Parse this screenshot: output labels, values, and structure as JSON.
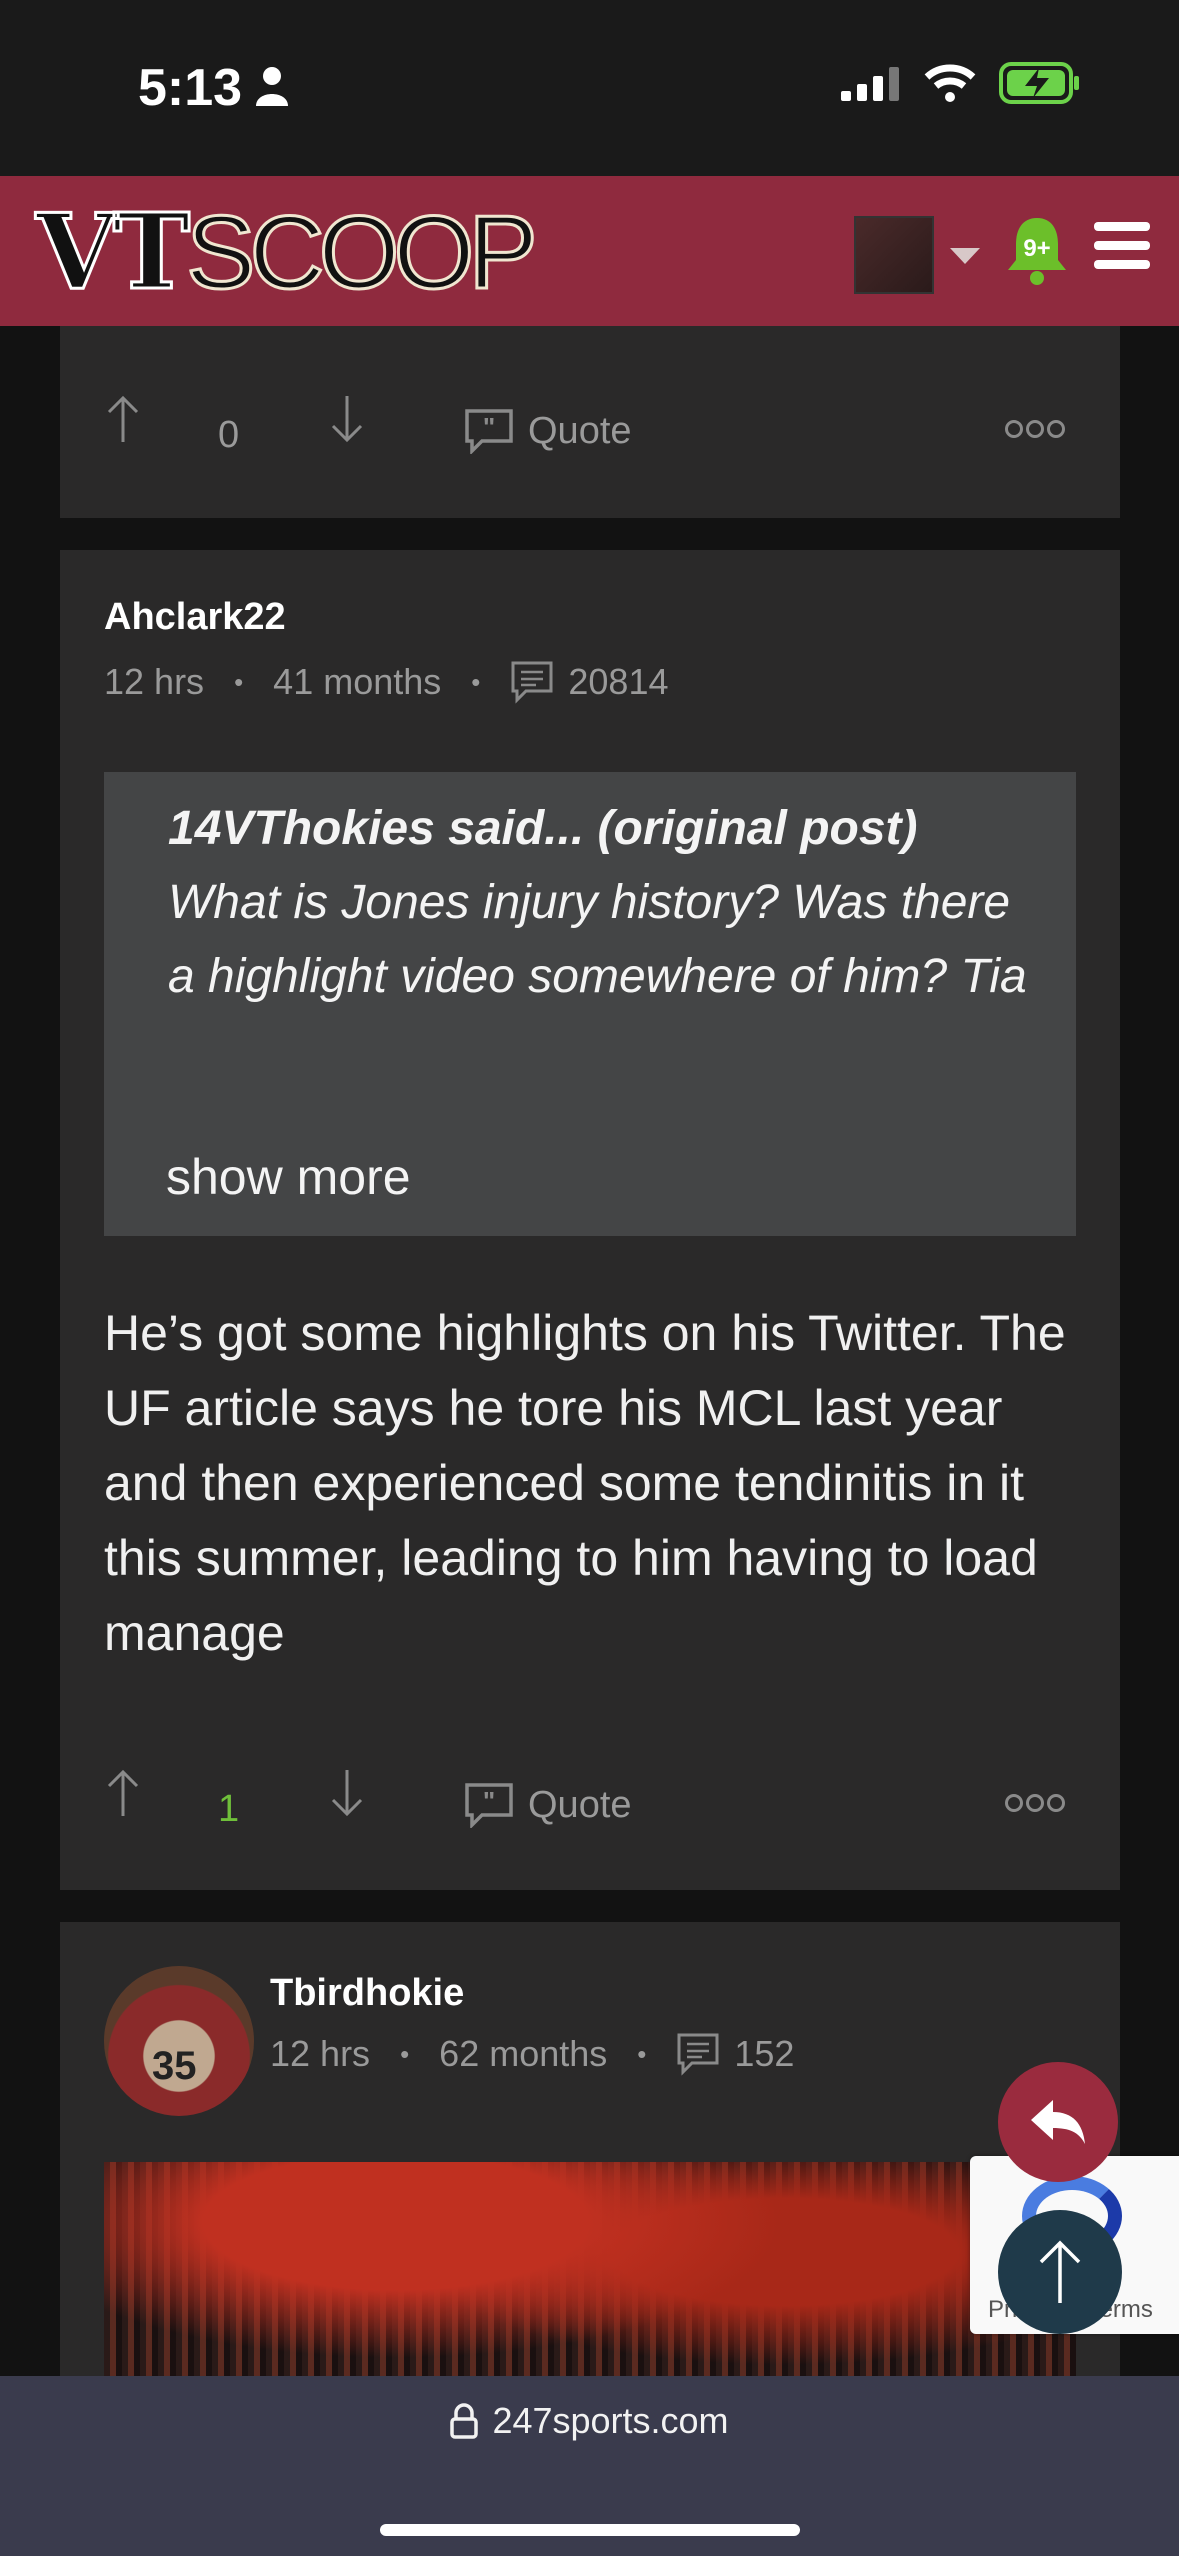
{
  "status_bar": {
    "time": "5:13"
  },
  "header": {
    "logo_vt": "VT",
    "logo_scoop": "SCOOP",
    "notification_badge": "9+"
  },
  "posts": [
    {
      "upvotes": "0",
      "quote_label": "Quote"
    },
    {
      "username": "Ahclark22",
      "posted": "12 hrs",
      "membership": "41 months",
      "post_count": "20814",
      "quote": {
        "attribution_name": "14VThokies said...",
        "attribution_link": "(original post)",
        "text": "What is Jones injury history? Was there a highlight video somewhere of him? Tia",
        "show_more": "show more"
      },
      "body": "He’s got some highlights on his Twitter. The UF article says he tore his MCL last year and then experienced some tendinitis in it this summer, leading to him having to load manage",
      "upvotes": "1",
      "quote_label": "Quote"
    },
    {
      "username": "Tbirdhokie",
      "posted": "12 hrs",
      "membership": "62 months",
      "post_count": "152",
      "avatar_number": "35"
    }
  ],
  "recaptcha": {
    "text": "Privacy - Terms"
  },
  "browser": {
    "url": "247sports.com"
  },
  "colors": {
    "header": "#8f2a3e",
    "card": "#2a2929",
    "upvote_green": "#6fbf3a",
    "fab_reply": "#9a2b3e",
    "fab_top": "#1f3a4a"
  }
}
